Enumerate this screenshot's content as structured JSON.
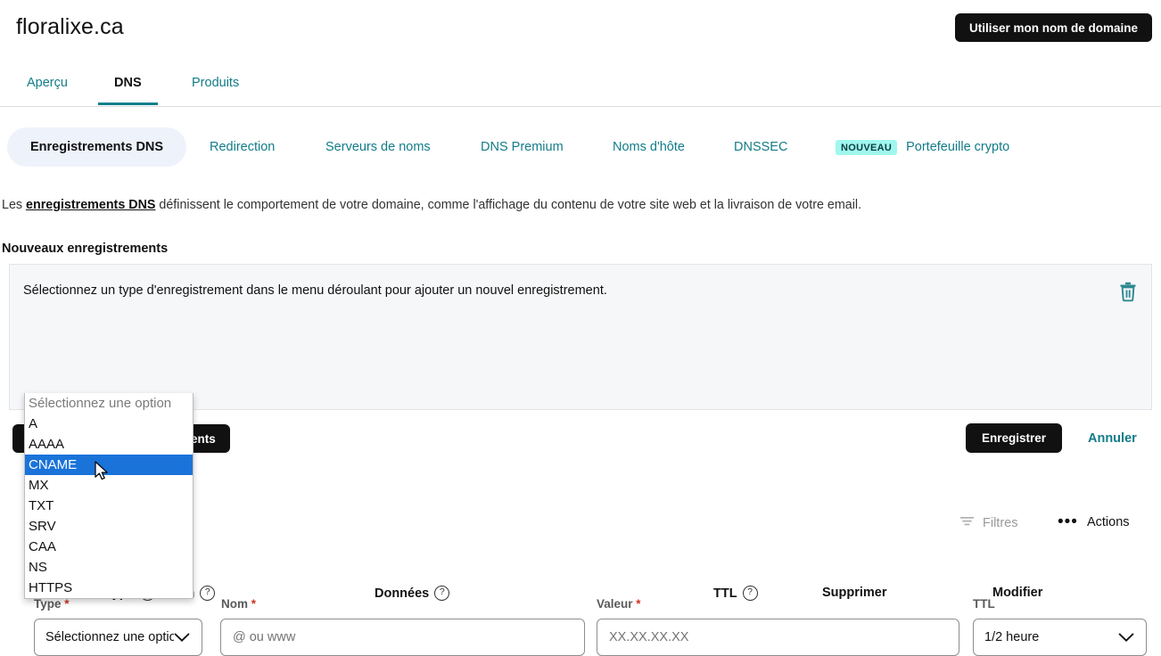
{
  "header": {
    "domain": "floralixe.ca",
    "use_domain_button": "Utiliser mon nom de domaine"
  },
  "tabs": [
    {
      "label": "Aperçu",
      "active": false
    },
    {
      "label": "DNS",
      "active": true
    },
    {
      "label": "Produits",
      "active": false
    }
  ],
  "subtabs": [
    {
      "label": "Enregistrements DNS",
      "active": true
    },
    {
      "label": "Redirection",
      "active": false
    },
    {
      "label": "Serveurs de noms",
      "active": false
    },
    {
      "label": "DNS Premium",
      "active": false
    },
    {
      "label": "Noms d'hôte",
      "active": false
    },
    {
      "label": "DNSSEC",
      "active": false
    },
    {
      "label": "Portefeuille crypto",
      "active": false,
      "badge": "NOUVEAU"
    }
  ],
  "description": {
    "prefix": "Les ",
    "link": "enregistrements DNS",
    "suffix": " définissent le comportement de votre domaine, comme l'affichage du contenu de votre site web et la livraison de votre email."
  },
  "section_title": "Nouveaux enregistrements",
  "panel": {
    "hint": "Sélectionnez un type d'enregistrement dans le menu déroulant pour ajouter un nouvel enregistrement.",
    "delete_icon": "trash-icon",
    "fields": {
      "type": {
        "label": "Type",
        "required": "*",
        "value": "Sélectionnez une option"
      },
      "nom": {
        "label": "Nom",
        "required": "*",
        "placeholder": "@ ou www",
        "value": ""
      },
      "valeur": {
        "label": "Valeur",
        "required": "*",
        "placeholder": "XX.XX.XX.XX",
        "value": ""
      },
      "ttl": {
        "label": "TTL",
        "required": "",
        "value": "1/2 heure"
      }
    }
  },
  "type_dropdown": {
    "open": true,
    "options": [
      {
        "label": "Sélectionnez une option",
        "placeholder": true,
        "selected": false
      },
      {
        "label": "A",
        "placeholder": false,
        "selected": false
      },
      {
        "label": "AAAA",
        "placeholder": false,
        "selected": false
      },
      {
        "label": "CNAME",
        "placeholder": false,
        "selected": true
      },
      {
        "label": "MX",
        "placeholder": false,
        "selected": false
      },
      {
        "label": "TXT",
        "placeholder": false,
        "selected": false
      },
      {
        "label": "SRV",
        "placeholder": false,
        "selected": false
      },
      {
        "label": "CAA",
        "placeholder": false,
        "selected": false
      },
      {
        "label": "NS",
        "placeholder": false,
        "selected": false
      },
      {
        "label": "HTTPS",
        "placeholder": false,
        "selected": false
      }
    ],
    "highlight_color": "#1a73d9"
  },
  "actions_row": {
    "add_more": "Ajouter d'autres enregistrements",
    "save": "Enregistrer",
    "cancel": "Annuler"
  },
  "toolbar": {
    "filters": "Filtres",
    "actions": "Actions"
  },
  "table_headers": [
    {
      "label": "Type",
      "help": true
    },
    {
      "label": "Nom",
      "help": true
    },
    {
      "label": "Données",
      "help": true
    },
    {
      "label": "TTL",
      "help": true
    },
    {
      "label": "Supprimer",
      "help": false
    },
    {
      "label": "Modifier",
      "help": false
    }
  ],
  "colors": {
    "accent_teal": "#127c88",
    "dark_button": "#111111",
    "badge_new_bg": "#9ff7ee",
    "active_pill_bg": "#eef2fb",
    "dropdown_highlight": "#1a73d9"
  }
}
